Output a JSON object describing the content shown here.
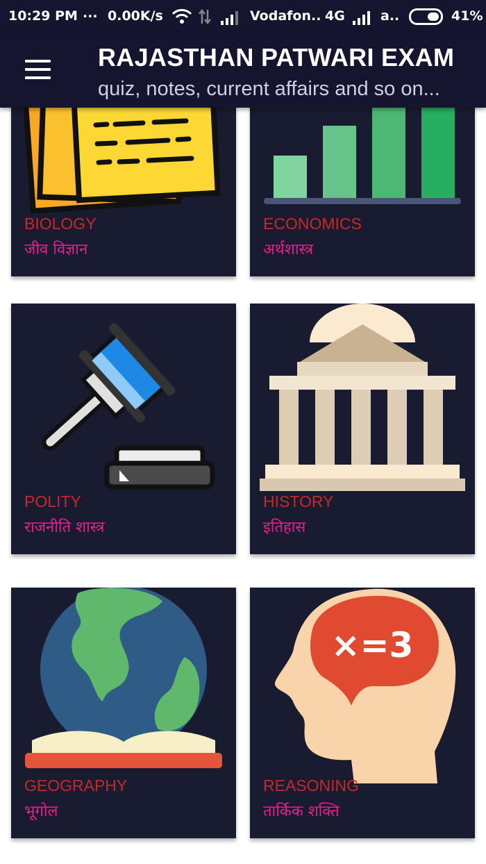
{
  "status_bar": {
    "time": "10:29 PM",
    "dots": "...",
    "speed": "0.00K/s",
    "carrier": "Vodafon..",
    "network": "4G",
    "carrier2": "a..",
    "battery": "41%"
  },
  "app_bar": {
    "title": "RAJASTHAN PATWARI EXAM",
    "subtitle": "quiz, notes, current affairs and so on..."
  },
  "subjects": [
    {
      "name_en": "BIOLOGY",
      "name_hi": "जीव विज्ञान"
    },
    {
      "name_en": "ECONOMICS",
      "name_hi": "अर्थशास्त्र"
    },
    {
      "name_en": "POLITY",
      "name_hi": "राजनीति शास्त्र"
    },
    {
      "name_en": "HISTORY",
      "name_hi": "इतिहास"
    },
    {
      "name_en": "GEOGRAPHY",
      "name_hi": "भूगोल"
    },
    {
      "name_en": "REASONING",
      "name_hi": "तार्किक शक्ति"
    }
  ],
  "reasoning_icon_text": "×=3",
  "colors": {
    "bar_background": "#151530",
    "card_background": "#191c30",
    "english_label": "#c62828",
    "hindi_label": "#e91e8c"
  }
}
